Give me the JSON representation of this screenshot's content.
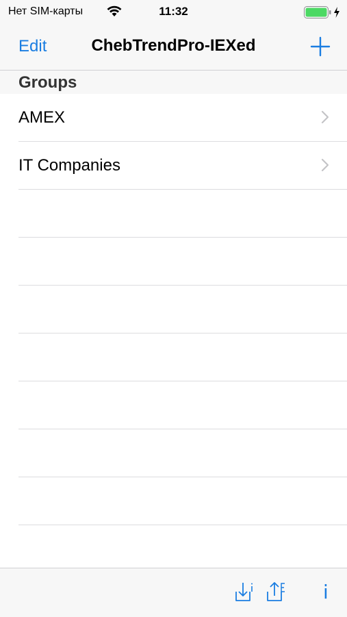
{
  "status_bar": {
    "carrier": "Нет SIM-карты",
    "time": "11:32",
    "battery_color": "#4cd964",
    "icons": [
      "wifi-icon",
      "battery-icon",
      "charging-bolt-icon"
    ]
  },
  "nav_bar": {
    "edit_label": "Edit",
    "title": "ChebTrendPro-IEXed",
    "add_icon": "plus-icon",
    "accent_color": "#1a7de1"
  },
  "section": {
    "header": "Groups"
  },
  "groups": [
    {
      "label": "AMEX"
    },
    {
      "label": "IT Companies"
    }
  ],
  "toolbar": {
    "import_icon": "import-download-icon",
    "export_icon": "export-upload-icon",
    "info_label": "i"
  }
}
